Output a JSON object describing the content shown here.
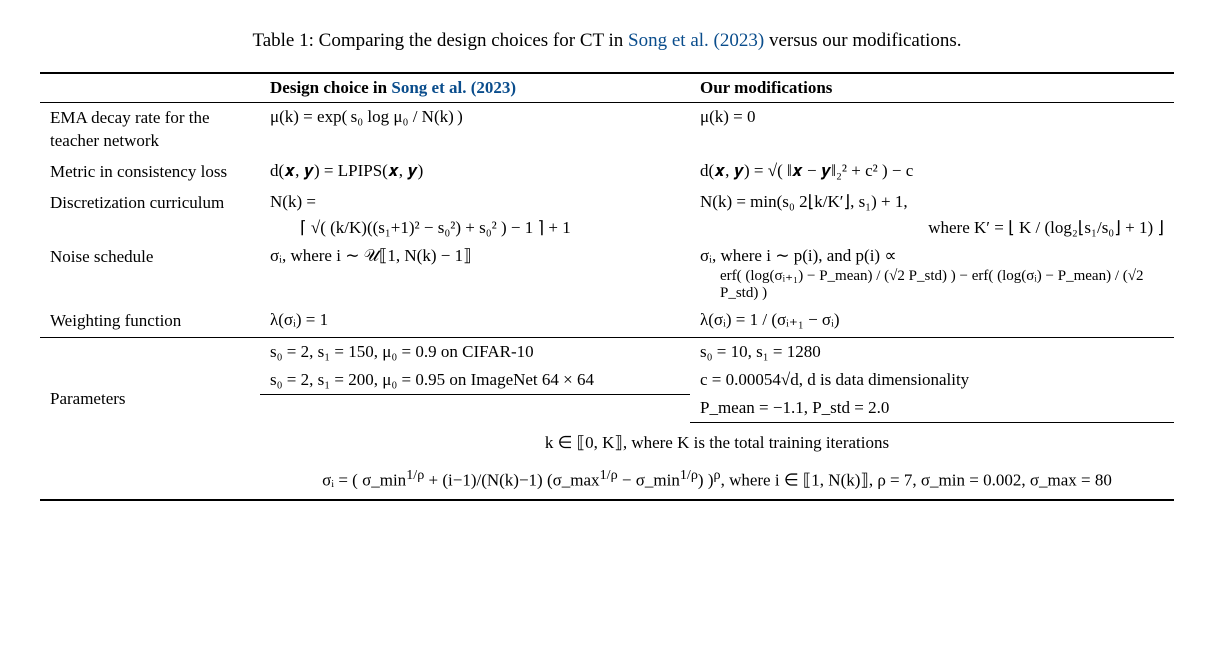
{
  "caption": {
    "prefix": "Table 1: Comparing the design choices for CT in ",
    "cite": "Song et al. (2023)",
    "suffix": " versus our modifications."
  },
  "header": {
    "col2_prefix": "Design choice in ",
    "col2_cite": "Song et al. (2023)",
    "col3": "Our modifications"
  },
  "rows": {
    "ema": {
      "label": "EMA decay rate for the teacher network",
      "song": "μ(k) = exp( s₀ log μ₀ / N(k) )",
      "ours": "μ(k) = 0"
    },
    "metric": {
      "label": "Metric in consistency loss",
      "song": "d(𝒙, 𝒚) = LPIPS(𝒙, 𝒚)",
      "ours": "d(𝒙, 𝒚) = √( ‖𝒙 − 𝒚‖₂² + c² ) − c"
    },
    "disc": {
      "label": "Discretization curriculum",
      "song_line1": "N(k) =",
      "song_line2": "⌈ √( (k/K)((s₁+1)² − s₀²) + s₀² ) − 1 ⌉ + 1",
      "ours_line1": "N(k) = min(s₀ 2⌊k/K′⌋, s₁) + 1,",
      "ours_line2": "where K′ = ⌊ K / (log₂⌊s₁/s₀⌋ + 1) ⌋"
    },
    "noise": {
      "label": "Noise schedule",
      "song": "σᵢ, where i ∼ 𝒰⟦1, N(k) − 1⟧",
      "ours_line1": "σᵢ, where i ∼ p(i), and p(i) ∝",
      "ours_line2": "erf( (log(σᵢ₊₁) − P_mean) / (√2 P_std) ) − erf( (log(σᵢ) − P_mean) / (√2 P_std) )"
    },
    "weight": {
      "label": "Weighting function",
      "song": "λ(σᵢ) = 1",
      "ours": "λ(σᵢ) = 1 / (σᵢ₊₁ − σᵢ)"
    },
    "params": {
      "label": "Parameters",
      "song_line1": "s₀ = 2, s₁ = 150, μ₀ = 0.9 on CIFAR-10",
      "song_line2": "s₀ = 2, s₁ = 200, μ₀ = 0.95 on ImageNet 64 × 64",
      "ours_line1": "s₀ = 10, s₁ = 1280",
      "ours_line2": "c = 0.00054√d, d is data dimensionality",
      "ours_line3": "P_mean = −1.1, P_std = 2.0",
      "shared_line1": "k ∈ ⟦0, K⟧, where K is the total training iterations",
      "shared_sigma_prefix": "σᵢ = ( σ_min",
      "shared_sigma_exp1": "1/ρ",
      "shared_sigma_mid1": " + (i−1)/(N(k)−1) (σ_max",
      "shared_sigma_mid2": " − σ_min",
      "shared_sigma_mid3": ") )",
      "shared_sigma_expp": "ρ",
      "shared_sigma_suffix": ", where i ∈ ⟦1, N(k)⟧, ρ = 7, σ_min = 0.002, σ_max = 80"
    }
  }
}
